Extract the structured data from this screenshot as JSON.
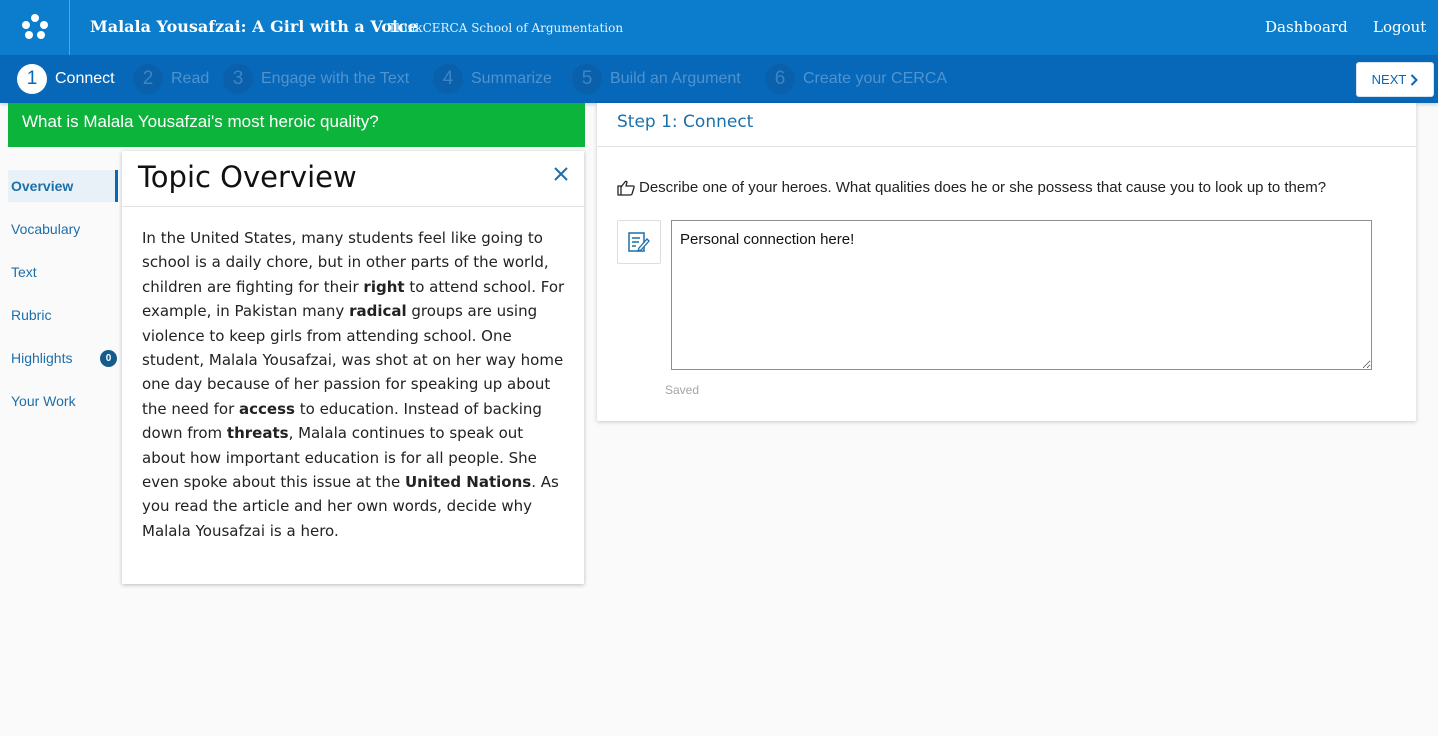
{
  "header": {
    "title": "Malala Yousafzai: A Girl with a Voice",
    "subtitle": "ThinkCERCA School of Argumentation",
    "links": [
      {
        "label": "Dashboard"
      },
      {
        "label": "Logout"
      }
    ],
    "logo_icon": "dots-logo-icon",
    "color": "#0b7dcc"
  },
  "steps": [
    {
      "num": "1",
      "label": "Connect",
      "active": true
    },
    {
      "num": "2",
      "label": "Read",
      "active": false
    },
    {
      "num": "3",
      "label": "Engage with the Text",
      "active": false
    },
    {
      "num": "4",
      "label": "Summarize",
      "active": false
    },
    {
      "num": "5",
      "label": "Build an Argument",
      "active": false
    },
    {
      "num": "6",
      "label": "Create your CERCA",
      "active": false
    }
  ],
  "next_button": {
    "label": "NEXT",
    "icon": "chevron-right-icon"
  },
  "question": {
    "text": "What is Malala Yousafzai's most heroic quality?",
    "color": "#0cb43b"
  },
  "sidebar": {
    "items": [
      {
        "label": "Overview",
        "active": true
      },
      {
        "label": "Vocabulary"
      },
      {
        "label": "Text"
      },
      {
        "label": "Rubric"
      },
      {
        "label": "Highlights",
        "badge": "0"
      },
      {
        "label": "Your Work"
      }
    ]
  },
  "topic": {
    "title": "Topic Overview",
    "close_icon": "close-icon",
    "segments": [
      {
        "text": "In the United States, many students feel like going to school is a daily chore, but in other parts of the world, children are fighting for their ",
        "bold": false
      },
      {
        "text": "right",
        "bold": true
      },
      {
        "text": " to attend school. For example, in Pakistan many ",
        "bold": false
      },
      {
        "text": "radical",
        "bold": true
      },
      {
        "text": " groups are using violence to keep girls from attending school. One student, Malala Yousafzai, was shot at on her way home one day because of her passion for speaking up about the need for ",
        "bold": false
      },
      {
        "text": "access",
        "bold": true
      },
      {
        "text": " to education. Instead of backing down from ",
        "bold": false
      },
      {
        "text": "threats",
        "bold": true
      },
      {
        "text": ", Malala continues to speak out about how important education is for all people. She even spoke about this issue at the ",
        "bold": false
      },
      {
        "text": "United Nations",
        "bold": true
      },
      {
        "text": ". As you read the article and her own words, decide why Malala Yousafzai is a hero.",
        "bold": false
      }
    ]
  },
  "connect": {
    "heading": "Step 1: Connect",
    "prompt_icon": "pointing-hand-icon",
    "prompt": "Describe one of your heroes. What qualities does he or she possess that cause you to look up to them?",
    "edit_icon": "edit-note-icon",
    "answer_value": "Personal connection here!",
    "status": "Saved"
  }
}
